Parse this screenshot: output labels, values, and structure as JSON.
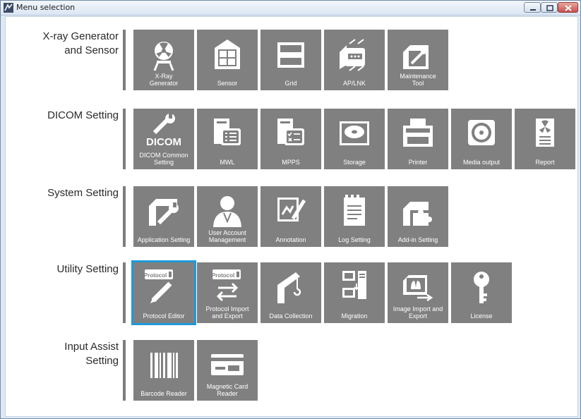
{
  "window": {
    "title": "Menu selection"
  },
  "sections": [
    {
      "label": "X-ray Generator\nand Sensor",
      "tiles": [
        {
          "label": "X-Ray\nGenerator",
          "icon": "xray-generator-icon"
        },
        {
          "label": "Sensor",
          "icon": "sensor-icon"
        },
        {
          "label": "Grid",
          "icon": "grid-icon"
        },
        {
          "label": "AP/LNK",
          "icon": "ap-lnk-icon"
        },
        {
          "label": "Maintenance\nTool",
          "icon": "maintenance-tool-icon"
        }
      ]
    },
    {
      "label": "DICOM Setting",
      "tiles": [
        {
          "label": "DICOM Common\nSetting",
          "icon": "dicom-wrench-icon",
          "icon_text": "DICOM"
        },
        {
          "label": "MWL",
          "icon": "mwl-document-icon"
        },
        {
          "label": "MPPS",
          "icon": "mpps-document-icon"
        },
        {
          "label": "Storage",
          "icon": "storage-drive-icon"
        },
        {
          "label": "Printer",
          "icon": "printer-icon"
        },
        {
          "label": "Media output",
          "icon": "disc-icon"
        },
        {
          "label": "Report",
          "icon": "report-icon"
        }
      ]
    },
    {
      "label": "System Setting",
      "tiles": [
        {
          "label": "Application Setting",
          "icon": "application-wrench-icon"
        },
        {
          "label": "User Account\nManagement",
          "icon": "user-icon"
        },
        {
          "label": "Annotation",
          "icon": "annotation-icon"
        },
        {
          "label": "Log Setting",
          "icon": "log-clipboard-icon"
        },
        {
          "label": "Add-in Setting",
          "icon": "puzzle-icon"
        }
      ]
    },
    {
      "label": "Utility Setting",
      "tiles": [
        {
          "label": "Protocol Editor",
          "icon": "protocol-edit-icon",
          "icon_text": "Protocol",
          "selected": true
        },
        {
          "label": "Protocol Import\nand Export",
          "icon": "protocol-transfer-icon",
          "icon_text": "Protocol"
        },
        {
          "label": "Data Collection",
          "icon": "crane-icon"
        },
        {
          "label": "Migration",
          "icon": "migration-icon"
        },
        {
          "label": "Image Import and\nExport",
          "icon": "image-transfer-icon"
        },
        {
          "label": "License",
          "icon": "key-icon"
        }
      ]
    },
    {
      "label": "Input Assist\nSetting",
      "tiles": [
        {
          "label": "Barcode Reader",
          "icon": "barcode-icon"
        },
        {
          "label": "Magnetic Card\nReader",
          "icon": "card-icon"
        }
      ]
    }
  ],
  "colors": {
    "tile": "#808080",
    "selection": "#1e9ad8",
    "separator": "#7d7d7d"
  }
}
